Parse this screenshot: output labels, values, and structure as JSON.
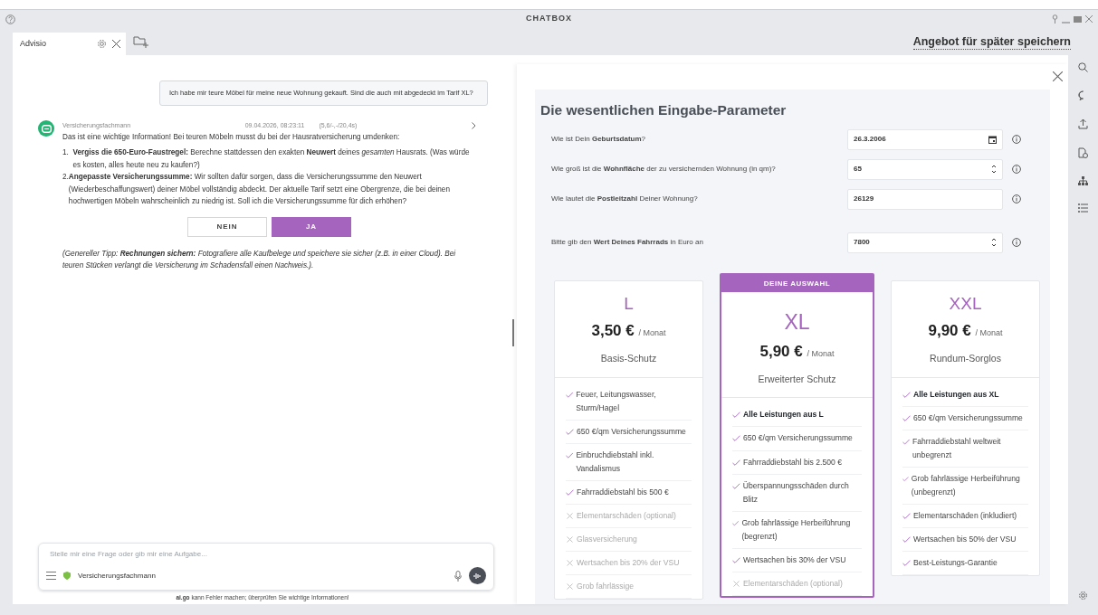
{
  "window": {
    "title": "CHATBOX"
  },
  "tabs": [
    {
      "label": "Advisio",
      "selected": true
    }
  ],
  "save_link": "Angebot für später speichern",
  "chat": {
    "user_message": "Ich habe mir teure Möbel für meine neue Wohnung gekauft. Sind die auch mit abgedeckt im Tarif XL?",
    "reply": {
      "sender": "Versicherungsfachmann",
      "timestamp": "09.04.2026, 08:23:11",
      "stats": "(5,6/-,-/20,4s)",
      "intro": "Das ist eine wichtige Information! Bei teuren Möbeln musst du bei der Hausratversicherung umdenken:",
      "list": [
        {
          "number": "1.",
          "text": "**Vergiss die 650-Euro-Faustregel:** Berechne stattdessen den exakten **Neuwert** deines *gesamten* Hausrats. (Was würde es kosten, alles heute neu zu kaufen?)"
        },
        {
          "number": "2.",
          "text": "**Angepasste Versicherungssumme:** Wir sollten dafür sorgen, dass die Versicherungssumme den Neuwert (Wiederbeschaffungswert) deiner Möbel vollständig abdeckt. Der aktuelle Tarif setzt eine Obergrenze, die bei deinen hochwertigen Möbeln wahrscheinlich zu niedrig ist. Soll ich die Versicherungssumme für dich erhöhen?"
        }
      ],
      "buttons": [
        {
          "label": "NEIN",
          "primary": false
        },
        {
          "label": "JA",
          "primary": true
        }
      ],
      "tip": "(Genereller Tipp: **Rechnungen sichern:** Fotografiere alle Kaufbelege und speichere sie sicher (z.B. in einer Cloud). Bei teuren Stücken verlangt die Versicherung im Schadensfall einen Nachweis.)."
    }
  },
  "composer": {
    "placeholder": "Stelle mir eine Frage oder gib mir eine Aufgabe...",
    "assistant": "Versicherungsfachmann"
  },
  "disclaimer": "**ai.go** kann Fehler machen; überprüfen Sie wichtige Informationen!",
  "params": {
    "title": "Die wesentlichen Eingabe-Parameter",
    "fields": [
      {
        "label": "Wie ist Dein **Geburtsdatum**?",
        "value": "26.3.2006",
        "kind": "date"
      },
      {
        "label": "Wie groß ist die **Wohnfläche** der zu versichernden Wohnung (in qm)?",
        "value": "65",
        "kind": "number"
      },
      {
        "label": "Wie lautet die **Postleitzahl** Deiner Wohnung?",
        "value": "26129",
        "kind": "text"
      },
      {
        "label": "Bitte gib den **Wert Deines Fahrrads** in Euro an",
        "value": "7800",
        "kind": "number"
      }
    ]
  },
  "plans": [
    {
      "name": "L",
      "price": "3,50 €",
      "unit": "/ Monat",
      "subtitle": "Basis-Schutz",
      "selected": false,
      "features": [
        {
          "text": "Feuer, Leitungswasser, Sturm/Hagel",
          "included": true,
          "bold": false
        },
        {
          "text": "650 €/qm Versicherungssumme",
          "included": true,
          "bold": false
        },
        {
          "text": "Einbruchdiebstahl inkl. Vandalismus",
          "included": true,
          "bold": false
        },
        {
          "text": "Fahrraddiebstahl bis 500 €",
          "included": true,
          "bold": false
        },
        {
          "text": "Elementarschäden (optional)",
          "included": false,
          "bold": false
        },
        {
          "text": "Glasversicherung",
          "included": false,
          "bold": false
        },
        {
          "text": "Wertsachen bis 20% der VSU",
          "included": false,
          "bold": false
        },
        {
          "text": "Grob fahrlässige",
          "included": false,
          "bold": false
        }
      ]
    },
    {
      "name": "XL",
      "price": "5,90 €",
      "unit": "/ Monat",
      "subtitle": "Erweiterter Schutz",
      "selected": true,
      "badge": "DEINE AUSWAHL",
      "features": [
        {
          "text": "Alle Leistungen aus L",
          "included": true,
          "bold": true
        },
        {
          "text": "650 €/qm Versicherungssumme",
          "included": true,
          "bold": false
        },
        {
          "text": "Fahrraddiebstahl bis 2.500 €",
          "included": true,
          "bold": false
        },
        {
          "text": "Überspannungsschäden durch Blitz",
          "included": true,
          "bold": false
        },
        {
          "text": "Grob fahrlässige Herbeiführung (begrenzt)",
          "included": true,
          "bold": false
        },
        {
          "text": "Wertsachen bis 30% der VSU",
          "included": true,
          "bold": false
        },
        {
          "text": "Elementarschäden (optional)",
          "included": false,
          "bold": false
        }
      ]
    },
    {
      "name": "XXL",
      "price": "9,90 €",
      "unit": "/ Monat",
      "subtitle": "Rundum-Sorglos",
      "selected": false,
      "features": [
        {
          "text": "Alle Leistungen aus XL",
          "included": true,
          "bold": true
        },
        {
          "text": "650 €/qm Versicherungssumme",
          "included": true,
          "bold": false
        },
        {
          "text": "Fahrraddiebstahl weltweit unbegrenzt",
          "included": true,
          "bold": false
        },
        {
          "text": "Grob fahrlässige Herbeiführung (unbegrenzt)",
          "included": true,
          "bold": false
        },
        {
          "text": "Elementarschäden (inkludiert)",
          "included": true,
          "bold": false
        },
        {
          "text": "Wertsachen bis 50% der VSU",
          "included": true,
          "bold": false
        },
        {
          "text": "Best-Leistungs-Garantie",
          "included": true,
          "bold": false
        }
      ]
    }
  ]
}
